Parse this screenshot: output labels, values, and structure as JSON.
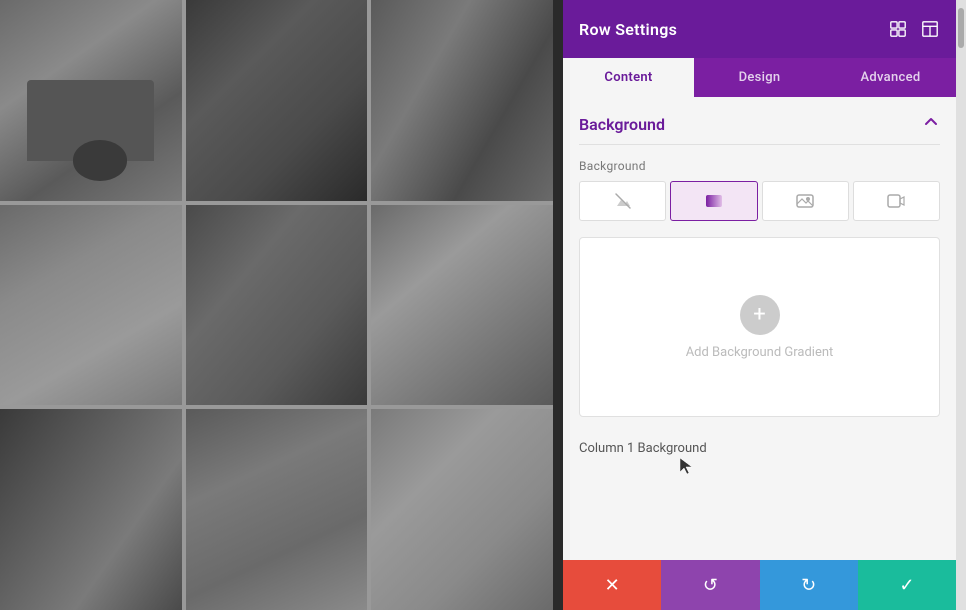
{
  "panel": {
    "title": "Row Settings",
    "tabs": [
      {
        "id": "content",
        "label": "Content",
        "active": true
      },
      {
        "id": "design",
        "label": "Design",
        "active": false
      },
      {
        "id": "advanced",
        "label": "Advanced",
        "active": false
      }
    ],
    "section": {
      "title": "Background",
      "collapsed": false,
      "field_label": "Background",
      "bg_types": [
        {
          "id": "clear",
          "icon": "✕",
          "active": false,
          "label": "Clear"
        },
        {
          "id": "gradient",
          "icon": "◲",
          "active": true,
          "label": "Gradient"
        },
        {
          "id": "image",
          "icon": "🖼",
          "active": false,
          "label": "Image"
        },
        {
          "id": "video",
          "icon": "▷",
          "active": false,
          "label": "Video"
        }
      ],
      "gradient_add_label": "Add Background Gradient",
      "col_bg_label": "Column 1 Background"
    }
  },
  "toolbar": {
    "cancel_label": "✕",
    "undo_label": "↺",
    "redo_label": "↻",
    "confirm_label": "✓"
  },
  "icons": {
    "expand": "⊡",
    "layout": "⊞",
    "chevron_up": "^",
    "plus": "+"
  }
}
